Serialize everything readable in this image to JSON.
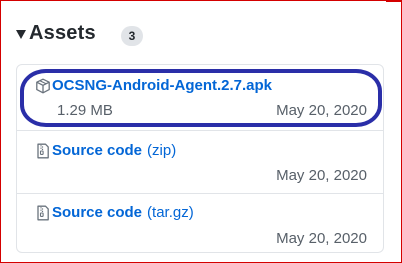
{
  "section": {
    "title": "Assets",
    "count": "3"
  },
  "assets": [
    {
      "name": "OCSNG-Android-Agent.2.7.apk",
      "ext": "",
      "size": "1.29 MB",
      "date": "May 20, 2020",
      "icon": "package-icon"
    },
    {
      "name": "Source code",
      "ext": "(zip)",
      "size": "",
      "date": "May 20, 2020",
      "icon": "file-zip-icon"
    },
    {
      "name": "Source code",
      "ext": "(tar.gz)",
      "size": "",
      "date": "May 20, 2020",
      "icon": "file-zip-icon"
    }
  ],
  "colors": {
    "link": "#0366d6",
    "muted": "#586069",
    "annotation_ellipse": "#2a2ea8",
    "annotation_frame": "#d40000"
  }
}
